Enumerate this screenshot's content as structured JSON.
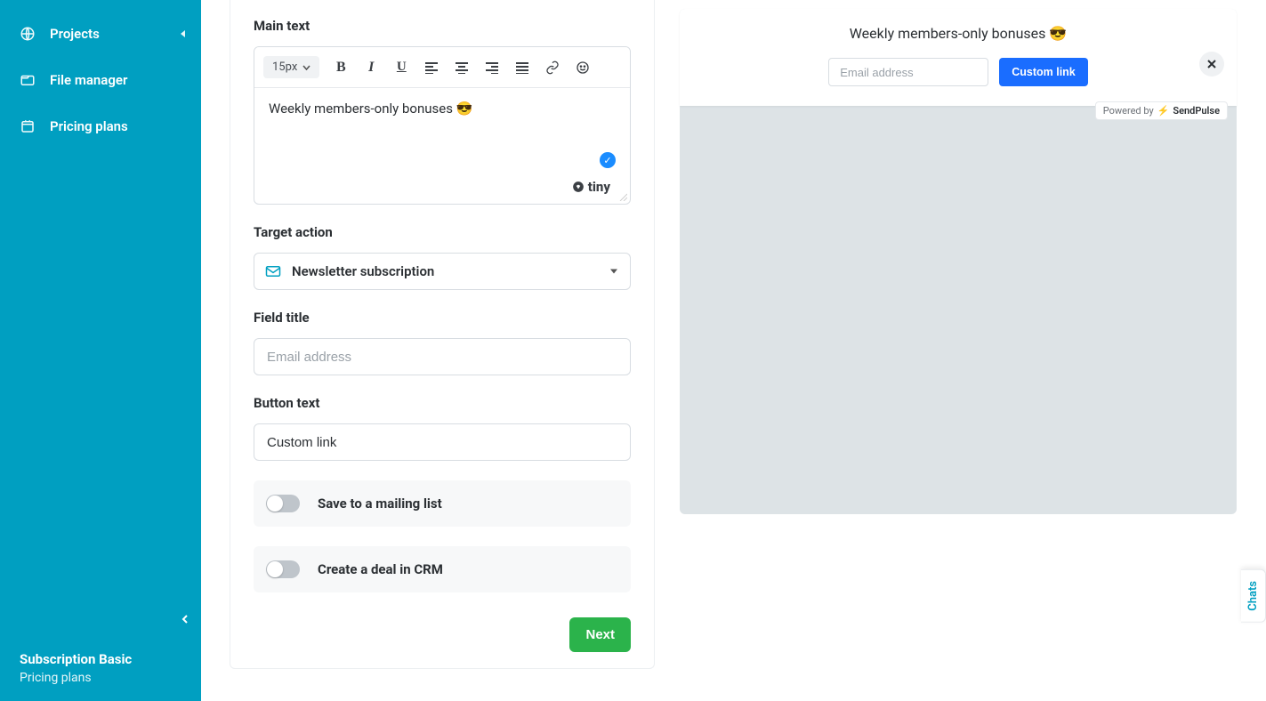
{
  "sidebar": {
    "items": [
      {
        "label": "Projects",
        "icon": "globe"
      },
      {
        "label": "File manager",
        "icon": "folder"
      },
      {
        "label": "Pricing plans",
        "icon": "calendar"
      }
    ],
    "footer": {
      "subscription": "Subscription Basic",
      "plans_link": "Pricing plans"
    }
  },
  "form": {
    "main_text_label": "Main text",
    "font_size": "15px",
    "editor_content": "Weekly members-only bonuses 😎",
    "editor_brand": "tiny",
    "target_action_label": "Target action",
    "target_action_value": "Newsletter subscription",
    "field_title_label": "Field title",
    "field_title_placeholder": "Email address",
    "field_title_value": "",
    "button_text_label": "Button text",
    "button_text_value": "Custom link",
    "toggle_mailing": "Save to a mailing list",
    "toggle_crm": "Create a deal in CRM",
    "next_button": "Next"
  },
  "preview": {
    "title": "Weekly members-only bonuses 😎",
    "input_placeholder": "Email address",
    "button_label": "Custom link",
    "powered_prefix": "Powered by",
    "powered_brand": "SendPulse"
  },
  "chats_tab": "Chats"
}
